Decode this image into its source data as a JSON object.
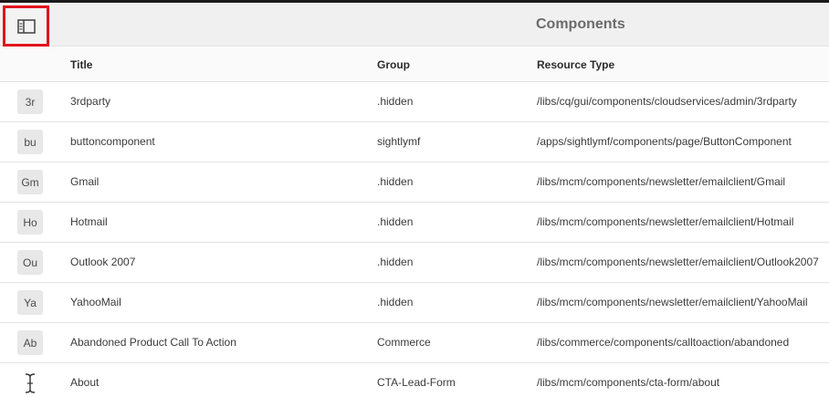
{
  "header": {
    "title": "Components",
    "rail_toggle_icon": "panel-toggle-icon",
    "highlight_color": "#e0141e"
  },
  "columns": {
    "title": "Title",
    "group": "Group",
    "resource_type": "Resource Type"
  },
  "rows": [
    {
      "thumb": "3r",
      "title": "3rdparty",
      "group": ".hidden",
      "resource_type": "/libs/cq/gui/components/cloudservices/admin/3rdparty"
    },
    {
      "thumb": "bu",
      "title": "buttoncomponent",
      "group": "sightlymf",
      "resource_type": "/apps/sightlymf/components/page/ButtonComponent"
    },
    {
      "thumb": "Gm",
      "title": "Gmail",
      "group": ".hidden",
      "resource_type": "/libs/mcm/components/newsletter/emailclient/Gmail"
    },
    {
      "thumb": "Ho",
      "title": "Hotmail",
      "group": ".hidden",
      "resource_type": "/libs/mcm/components/newsletter/emailclient/Hotmail"
    },
    {
      "thumb": "Ou",
      "title": "Outlook 2007",
      "group": ".hidden",
      "resource_type": "/libs/mcm/components/newsletter/emailclient/Outlook2007"
    },
    {
      "thumb": "Ya",
      "title": "YahooMail",
      "group": ".hidden",
      "resource_type": "/libs/mcm/components/newsletter/emailclient/YahooMail"
    },
    {
      "thumb": "Ab",
      "title": "Abandoned Product Call To Action",
      "group": "Commerce",
      "resource_type": "/libs/commerce/components/calltoaction/abandoned"
    },
    {
      "thumb": "",
      "thumb_icon": "text-cursor-icon",
      "title": "About",
      "group": "CTA-Lead-Form",
      "resource_type": "/libs/mcm/components/cta-form/about"
    }
  ]
}
